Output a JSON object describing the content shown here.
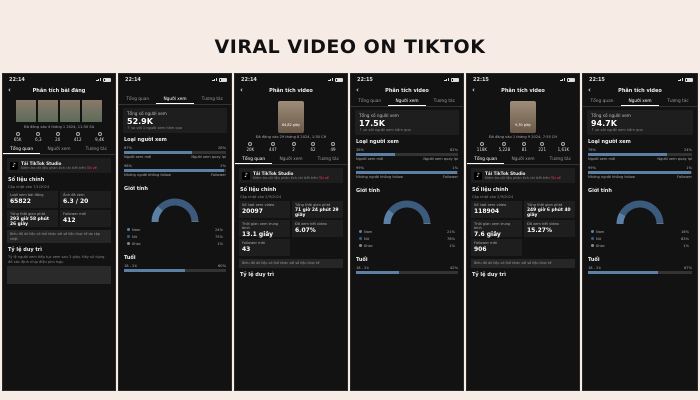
{
  "title": "VIRAL VIDEO ON TIKTOK",
  "phones": [
    {
      "time": "22:14",
      "header": "Phân tích bài đăng",
      "post_date": "Đã đăng vào 4 tháng 1 2024, 11:30 SA",
      "stats": [
        "65K",
        "6,3",
        "20",
        "412",
        "9,4K"
      ],
      "tabs": [
        "Tổng quan",
        "Người xem",
        "Tương tác"
      ],
      "studio_title": "Tải TikTok Studio",
      "studio_sub": "Kiểm tra dữ liệu phân tích chi tiết trên",
      "studio_new": "Tài về",
      "metrics_title": "Số liệu chính",
      "metrics_sub": "Cập nhật vào 7/1/2024",
      "cells": [
        {
          "k": "Lượt xem bài đăng",
          "v": "65822"
        },
        {
          "k": "Ảnh đã xem",
          "v": "6.3 / 20"
        },
        {
          "k": "Tổng thời gian phát",
          "v": "293 giờ 58 phút 26 giây"
        },
        {
          "k": "Follower mới",
          "v": "412"
        }
      ],
      "note": "Biểu đồ dữ liệu có thể khác với số liệu thực tế do cập nhật",
      "ratio_title": "Tỷ lệ duy trì",
      "ratio_text": "Tỷ lệ người xem tiếp tục xem sau 3 giây. Hãy sử dụng để xác định nhịp điệu phù hợp."
    },
    {
      "time": "22:14",
      "tabs": [
        "Tổng quan",
        "Người xem",
        "Tương tác"
      ],
      "total_label": "Tổng số người xem",
      "total_value": "52.9K",
      "total_sub": "↑ so với 1 người xem hôm qua",
      "type_label": "Loại người xem",
      "rows": [
        {
          "a": "67%",
          "b": "28%",
          "fill": 0.67
        },
        {
          "a": "98%",
          "b": "2%",
          "fill": 0.98
        }
      ],
      "row_caps": [
        [
          "Người xem mới",
          "Người xem quay lại"
        ],
        [
          "Những người không follow",
          "Follower"
        ]
      ],
      "gender_title": "Giới tính",
      "gender": [
        {
          "k": "Nam",
          "v": "24%",
          "c": "#5c7fa6"
        },
        {
          "k": "Nữ",
          "v": "75%",
          "c": "#3c5a7c"
        },
        {
          "k": "Khác",
          "v": "1%",
          "c": "#888888"
        }
      ],
      "age_title": "Tuổi",
      "age_row": {
        "k": "18 - 24",
        "v": "60%",
        "fill": 0.6
      }
    },
    {
      "time": "22:14",
      "header": "Phân tích video",
      "thumb_label": "64,82 giây",
      "post_date": "Đã đăng vào 29 tháng 8 2024, 1:30 CH",
      "stats": [
        "20K",
        "447",
        "2",
        "62",
        "49"
      ],
      "tabs": [
        "Tổng quan",
        "Người xem",
        "Tương tác"
      ],
      "studio_title": "Tải TikTok Studio",
      "studio_sub": "Kiểm tra dữ liệu phân tích chi tiết trên",
      "studio_new": "Tài về",
      "metrics_title": "Số liệu chính",
      "metrics_sub": "Cập nhật vào 2/9/2024",
      "cells": [
        {
          "k": "Số lượt xem video",
          "v": "20097"
        },
        {
          "k": "Tổng thời gian phát",
          "v": "71 giờ 24 phút 29 giây"
        },
        {
          "k": "Thời gian xem trung bình",
          "v": "13.1 giây"
        },
        {
          "k": "Đã xem hết video",
          "v": "6.07%"
        },
        {
          "k": "Follower mới",
          "v": "43"
        }
      ],
      "note": "Biểu đồ dữ liệu có thể khác với số liệu thực tế",
      "ratio_title": "Tỷ lệ duy trì"
    },
    {
      "time": "22:15",
      "header": "Phân tích video",
      "tabs": [
        "Tổng quan",
        "Người xem",
        "Tương tác"
      ],
      "total_label": "Tổng số người xem",
      "total_value": "17.5K",
      "total_sub": "↑ so với người xem hôm qua",
      "type_label": "Loại người xem",
      "rows": [
        {
          "a": "38%",
          "b": "62%",
          "fill": 0.38
        },
        {
          "a": "99%",
          "b": "1%",
          "fill": 0.99
        }
      ],
      "row_caps": [
        [
          "Người xem mới",
          "Người xem quay lại"
        ],
        [
          "Những người không follow",
          "Follower"
        ]
      ],
      "gender_title": "Giới tính",
      "gender": [
        {
          "k": "Nam",
          "v": "21%",
          "c": "#5c7fa6"
        },
        {
          "k": "Nữ",
          "v": "78%",
          "c": "#3c5a7c"
        },
        {
          "k": "Khác",
          "v": "1%",
          "c": "#888888"
        }
      ],
      "age_title": "Tuổi",
      "age_row": {
        "k": "18 - 24",
        "v": "42%",
        "fill": 0.42
      }
    },
    {
      "time": "22:15",
      "header": "Phân tích video",
      "thumb_label": "9,30 giây",
      "post_date": "Đã đăng vào 1 tháng 9 2024, 7:55 CH",
      "stats": [
        "118K",
        "5,228",
        "81",
        "221",
        "1,61K"
      ],
      "tabs": [
        "Tổng quan",
        "Người xem",
        "Tương tác"
      ],
      "studio_title": "Tải TikTok Studio",
      "studio_sub": "Kiểm tra dữ liệu phân tích chi tiết trên",
      "studio_new": "Tài về",
      "metrics_title": "Số liệu chính",
      "metrics_sub": "Cập nhật vào 2/9/2024",
      "cells": [
        {
          "k": "Số lượt xem video",
          "v": "118904"
        },
        {
          "k": "Tổng thời gian phát",
          "v": "249 giờ 6 phút 40 giây"
        },
        {
          "k": "Thời gian xem trung bình",
          "v": "7.6 giây"
        },
        {
          "k": "Đã xem hết video",
          "v": "15.27%"
        },
        {
          "k": "Follower mới",
          "v": "906"
        }
      ],
      "note": "Biểu đồ dữ liệu có thể khác với số liệu thực tế",
      "ratio_title": "Tỷ lệ duy trì"
    },
    {
      "time": "22:15",
      "header": "Phân tích video",
      "tabs": [
        "Tổng quan",
        "Người xem",
        "Tương tác"
      ],
      "total_label": "Tổng số người xem",
      "total_value": "94.7K",
      "total_sub": "↑ so với người xem hôm qua",
      "type_label": "Loại người xem",
      "rows": [
        {
          "a": "76%",
          "b": "24%",
          "fill": 0.76
        },
        {
          "a": "99%",
          "b": "1%",
          "fill": 0.99
        }
      ],
      "row_caps": [
        [
          "Người xem mới",
          "Người xem quay lại"
        ],
        [
          "Những người không follow",
          "Follower"
        ]
      ],
      "gender_title": "Giới tính",
      "gender": [
        {
          "k": "Nam",
          "v": "16%",
          "c": "#5c7fa6"
        },
        {
          "k": "Nữ",
          "v": "83%",
          "c": "#3c5a7c"
        },
        {
          "k": "Khác",
          "v": "1%",
          "c": "#888888"
        }
      ],
      "age_title": "Tuổi",
      "age_row": {
        "k": "18 - 24",
        "v": "67%",
        "fill": 0.67
      }
    }
  ]
}
